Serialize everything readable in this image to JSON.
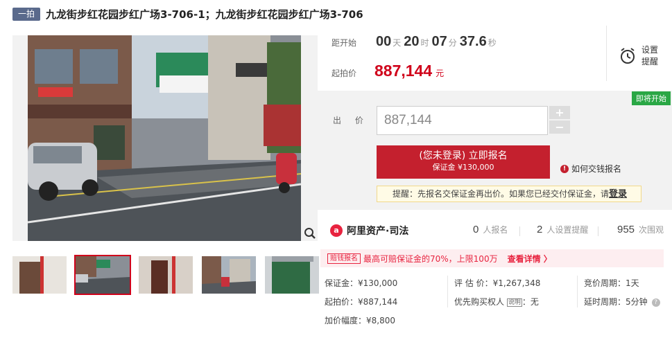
{
  "header": {
    "badge": "一拍",
    "title": "九龙街步红花园步红广场3-706-1；九龙街步红花园步红广场3-706"
  },
  "countdown": {
    "label": "距开始",
    "days": "00",
    "days_unit": "天",
    "hours": "20",
    "hours_unit": "时",
    "minutes": "07",
    "minutes_unit": "分",
    "seconds": "37.6",
    "seconds_unit": "秒"
  },
  "start_price": {
    "label": "起拍价",
    "value": "887,144",
    "unit": "元"
  },
  "remind": {
    "label_line1": "设置",
    "label_line2": "提醒"
  },
  "bid": {
    "status_badge": "即将开始",
    "label": "出 价",
    "input_value": "887,144",
    "plus": "+",
    "minus": "−",
    "register_main": "(您未登录) 立即报名",
    "register_sub": "保证金 ¥130,000",
    "howto": "如何交钱报名",
    "tip": "提醒：先报名交保证金再出价。如果您已经交付保证金，请",
    "tip_login": "登录"
  },
  "platform": {
    "logo_text": "阿里资产·司法",
    "signups_num": "0",
    "signups_label": "人报名",
    "reminders_num": "2",
    "reminders_label": "人设置提醒",
    "views_num": "955",
    "views_label": "次围观"
  },
  "promo": {
    "tag": "赔钱报名",
    "text": "最高可赔保证金的70%，上限100万",
    "link": "查看详情 〉"
  },
  "details": {
    "deposit": "保证金：¥130,000",
    "appraisal": "评 估 价：¥1,267,348",
    "cycle": "竞价周期：1天",
    "start": "起拍价：¥887,144",
    "priority_label": "优先购买权人",
    "priority_tag": "说明",
    "priority_value": "：无",
    "delay": "延时周期：5分钟",
    "increment": "加价幅度：¥8,800"
  },
  "colors": {
    "accent": "#c4202e",
    "price": "#d0021b",
    "soon": "#2aa745",
    "badge": "#5a6a8c"
  }
}
